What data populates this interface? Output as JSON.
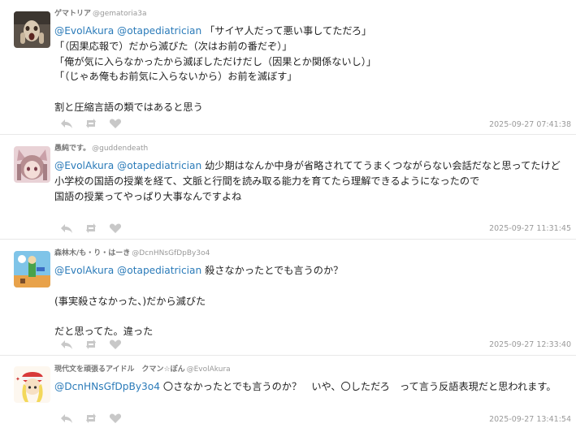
{
  "posts": [
    {
      "name": "ゲマトリア",
      "handle": "@gematoria3a",
      "m1": "@EvolAkura",
      "m2": "@otapediatrician",
      "first_rest": " 「サイヤ人だって悪い事してただろ」",
      "lines": [
        "「（因果応報で）だから滅びた（次はお前の番だぞ）」",
        "「俺が気に入らなかったから滅ぼしただけだし（因果とか関係ないし）」",
        "「（じゃあ俺もお前気に入らないから）お前を滅ぼす」",
        "",
        "割と圧縮言語の類ではあると思う"
      ],
      "timestamp": "2025-09-27 07:41:38"
    },
    {
      "name": "愚純です。",
      "handle": "@guddendeath",
      "m1": "@EvolAkura",
      "m2": "@otapediatrician",
      "first_rest": " 幼少期はなんか中身が省略されててうまくつながらない会話だなと思ってたけど",
      "lines": [
        "小学校の国語の授業を経て、文脈と行間を読み取る能力を育てたら理解できるようになったので",
        "国語の授業ってやっぱり大事なんですよね"
      ],
      "timestamp": "2025-09-27 11:31:45"
    },
    {
      "name": "森林木/も・り・はーき",
      "handle": "@DcnHNsGfDpBy3o4",
      "m1": "@EvolAkura",
      "m2": "@otapediatrician",
      "first_rest": " 殺さなかったとでも言うのか？",
      "lines": [
        "",
        "(事実殺さなかった、)だから滅びた",
        "",
        "だと思ってた。違った"
      ],
      "timestamp": "2025-09-27 12:33:40"
    },
    {
      "name": "現代文を頑張るアイドル　クマン☆ぽん",
      "handle": "@EvolAkura",
      "m1": "@DcnHNsGfDpBy3o4",
      "m2": "",
      "first_rest": " 〇さなかったとでも言うのか？　いや、〇しただろ　って言う反語表現だと思われます。",
      "lines": [],
      "timestamp": "2025-09-27 13:41:54"
    }
  ],
  "icons": {
    "reply": "reply-icon",
    "repost": "repost-icon",
    "like": "heart-icon"
  },
  "colors": {
    "mention": "#2b7bb9",
    "timestamp": "#9a9a9a",
    "icon": "#c8c8c8"
  }
}
